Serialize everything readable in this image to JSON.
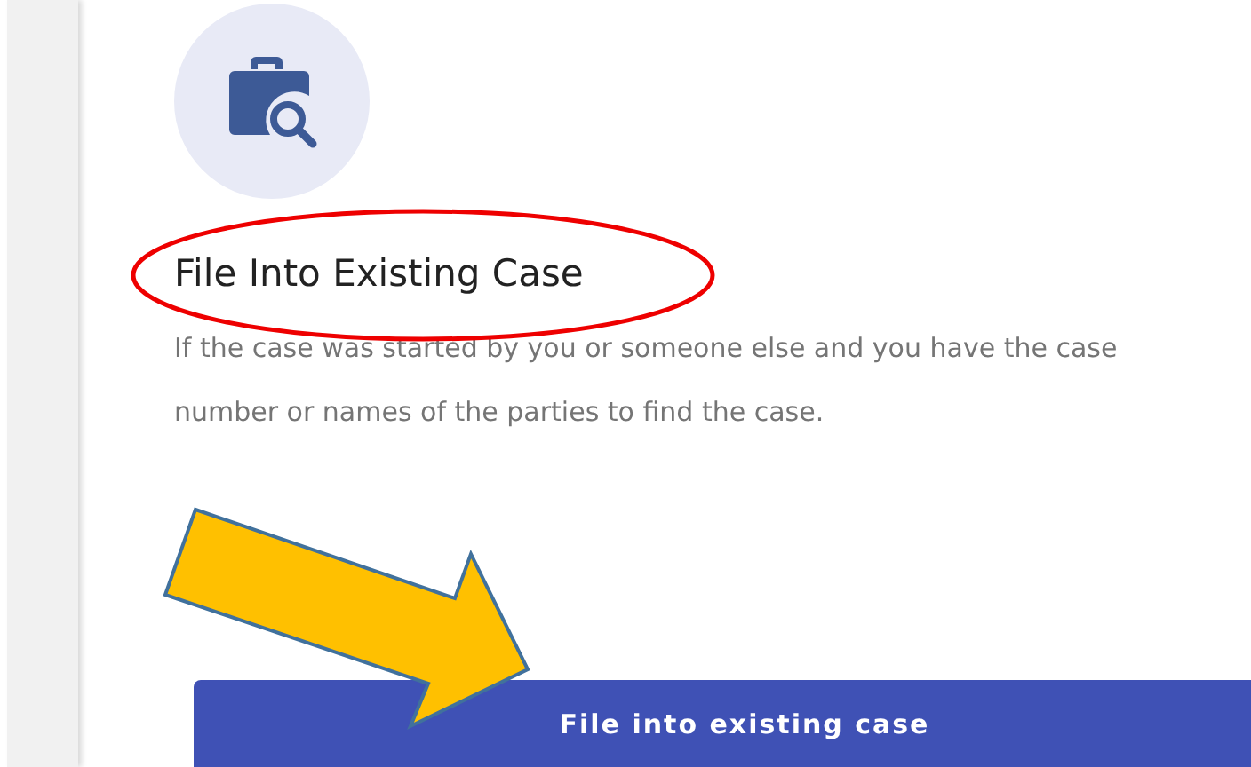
{
  "card": {
    "title": "File Into Existing Case",
    "description": "If the case was started by you or someone else and you have the case number or names of the parties to find the case.",
    "button": "File into existing case"
  },
  "annotations": [
    {
      "kind": "ellipse"
    },
    {
      "kind": "arrow"
    }
  ]
}
